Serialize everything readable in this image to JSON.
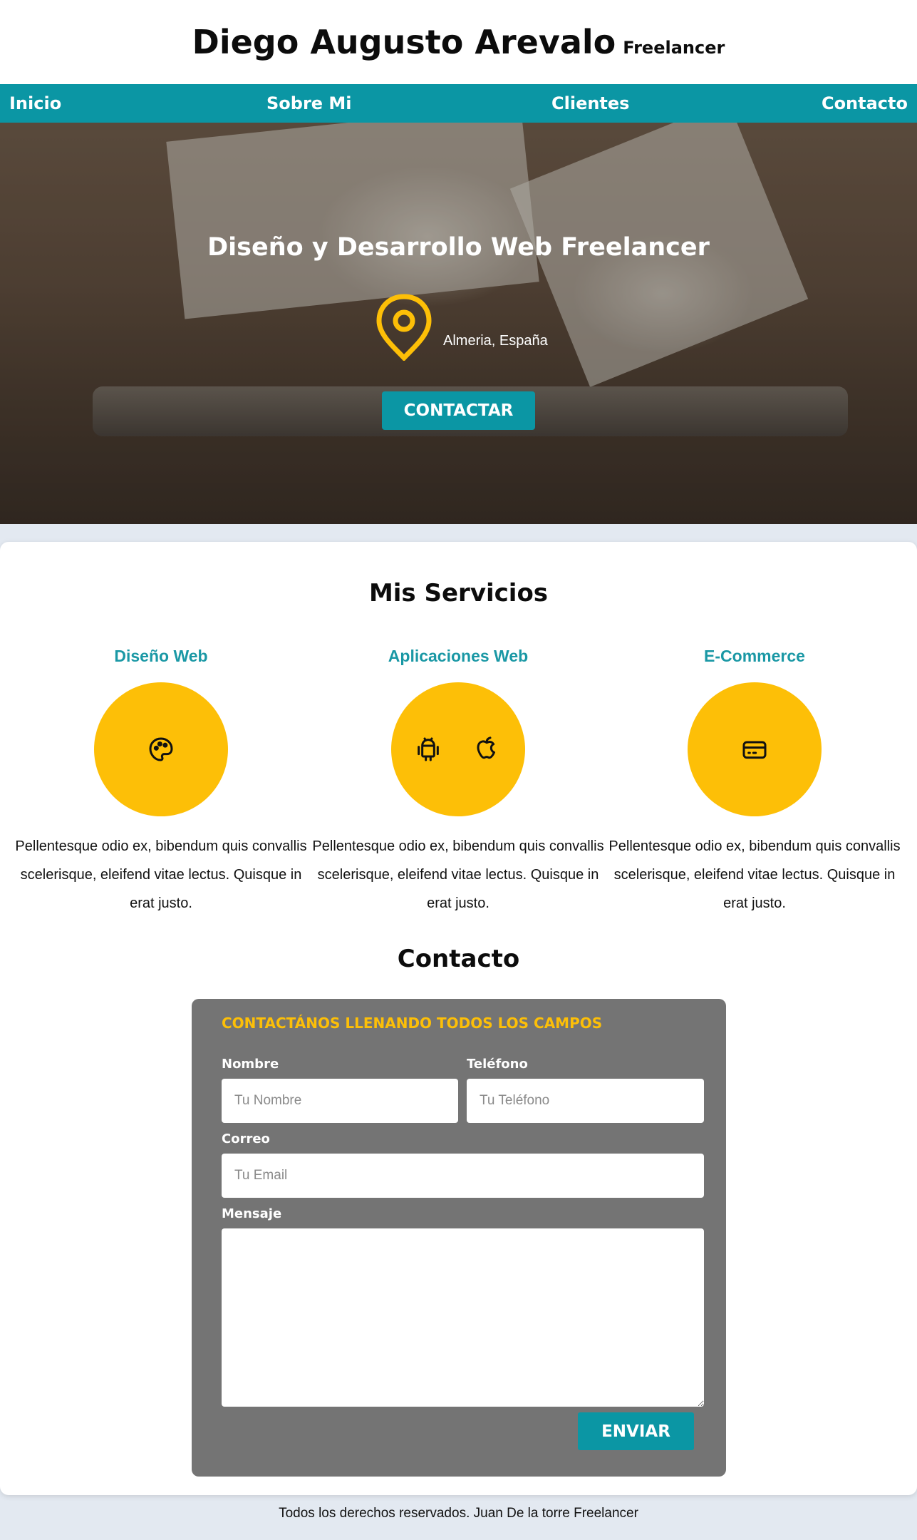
{
  "header": {
    "name": "Diego Augusto Arevalo",
    "role": "Freelancer"
  },
  "nav": {
    "inicio": "Inicio",
    "sobre_mi": "Sobre Mi",
    "clientes": "Clientes",
    "contacto": "Contacto"
  },
  "hero": {
    "title": "Diseño y Desarrollo Web Freelancer",
    "location": "Almeria, España",
    "cta": "CONTACTAR"
  },
  "services": {
    "title": "Mis Servicios",
    "items": [
      {
        "name": "Diseño Web",
        "icon": "palette-icon",
        "description": "Pellentesque odio ex, bibendum quis convallis scelerisque, eleifend vitae lectus. Quisque in erat justo."
      },
      {
        "name": "Aplicaciones Web",
        "icon": "android-apple-icons",
        "description": "Pellentesque odio ex, bibendum quis convallis scelerisque, eleifend vitae lectus. Quisque in erat justo."
      },
      {
        "name": "E-Commerce",
        "icon": "credit-card-icon",
        "description": "Pellentesque odio ex, bibendum quis convallis scelerisque, eleifend vitae lectus. Quisque in erat justo."
      }
    ]
  },
  "contact": {
    "title": "Contacto",
    "form_heading": "CONTACTÁNOS LLENANDO TODOS LOS CAMPOS",
    "name_label": "Nombre",
    "name_placeholder": "Tu Nombre",
    "phone_label": "Teléfono",
    "phone_placeholder": "Tu Teléfono",
    "email_label": "Correo",
    "email_placeholder": "Tu Email",
    "message_label": "Mensaje",
    "submit": "ENVIAR"
  },
  "footer": {
    "text": "Todos los derechos reservados. Juan De la torre Freelancer"
  },
  "colors": {
    "accent": "#0b96a4",
    "yellow": "#fdbf07",
    "form_bg": "#747474",
    "page_bg": "#e3e9f1"
  }
}
